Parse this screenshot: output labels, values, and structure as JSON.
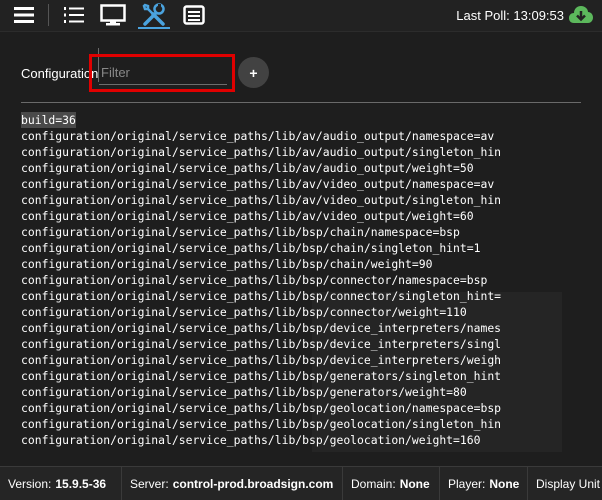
{
  "toolbar": {
    "last_poll_label": "Last Poll:",
    "last_poll_time": "13:09:53",
    "icons": [
      "hamburger-menu-icon",
      "list-icon",
      "monitor-icon",
      "tools-icon",
      "table-icon",
      "cloud-download-icon"
    ],
    "accent": "#4aa3df",
    "cloud_color": "#5cb85c"
  },
  "config": {
    "label": "Configuration",
    "filter_placeholder": "Filter",
    "filter_value": "",
    "add_label": "+",
    "highlight_color": "#e00000",
    "lines": [
      "build=36",
      "configuration/original/service_paths/lib/av/audio_output/namespace=av",
      "configuration/original/service_paths/lib/av/audio_output/singleton_hin",
      "configuration/original/service_paths/lib/av/audio_output/weight=50",
      "configuration/original/service_paths/lib/av/video_output/namespace=av",
      "configuration/original/service_paths/lib/av/video_output/singleton_hin",
      "configuration/original/service_paths/lib/av/video_output/weight=60",
      "configuration/original/service_paths/lib/bsp/chain/namespace=bsp",
      "configuration/original/service_paths/lib/bsp/chain/singleton_hint=1",
      "configuration/original/service_paths/lib/bsp/chain/weight=90",
      "configuration/original/service_paths/lib/bsp/connector/namespace=bsp",
      "configuration/original/service_paths/lib/bsp/connector/singleton_hint=",
      "configuration/original/service_paths/lib/bsp/connector/weight=110",
      "configuration/original/service_paths/lib/bsp/device_interpreters/names",
      "configuration/original/service_paths/lib/bsp/device_interpreters/singl",
      "configuration/original/service_paths/lib/bsp/device_interpreters/weigh",
      "configuration/original/service_paths/lib/bsp/generators/singleton_hint",
      "configuration/original/service_paths/lib/bsp/generators/weight=80",
      "configuration/original/service_paths/lib/bsp/geolocation/namespace=bsp",
      "configuration/original/service_paths/lib/bsp/geolocation/singleton_hin",
      "configuration/original/service_paths/lib/bsp/geolocation/weight=160"
    ]
  },
  "status": {
    "version_label": "Version:",
    "version_value": "15.9.5-36",
    "server_label": "Server:",
    "server_value": "control-prod.broadsign.com",
    "domain_label": "Domain:",
    "domain_value": "None",
    "player_label": "Player:",
    "player_value": "None",
    "display_label": "Display Unit"
  }
}
